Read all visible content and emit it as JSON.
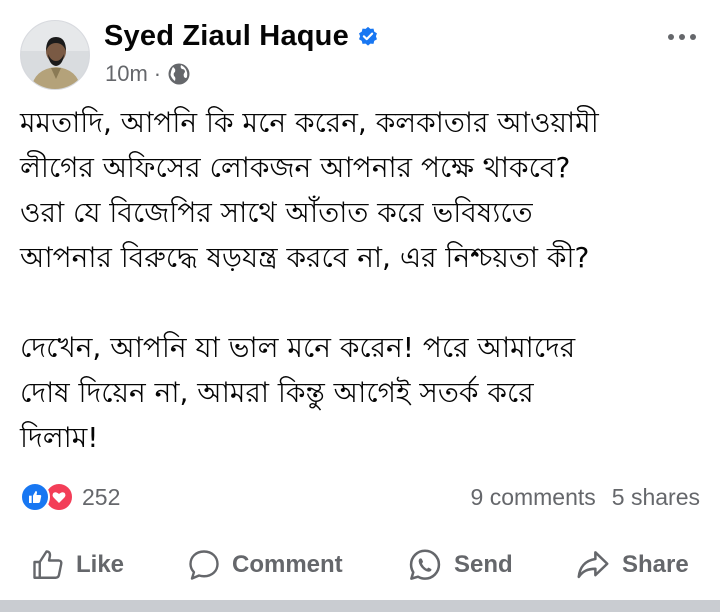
{
  "post": {
    "author": "Syed Ziaul Haque",
    "time": "10m",
    "separator": "·",
    "paragraphs": [
      "মমতাদি, আপনি কি মনে করেন, কলকাতার আওয়ামী\nলীগের অফিসের লোকজন আপনার পক্ষে থাকবে?\nওরা যে বিজেপির সাথে আঁতাত করে ভবিষ্যতে\nআপনার বিরুদ্ধে ষড়যন্ত্র করবে না, এর নিশ্চয়তা কী?",
      "দেখেন, আপনি যা ভাল মনে করেন! পরে আমাদের\nদোষ দিয়েন না, আমরা কিন্তু আগেই সতর্ক করে\nদিলাম!"
    ],
    "reaction_count": "252",
    "comments": "9 comments",
    "shares": "5 shares"
  },
  "actions": {
    "like": "Like",
    "comment": "Comment",
    "send": "Send",
    "share": "Share"
  },
  "icons": {
    "verified": "verified-badge-icon",
    "privacy": "globe-icon",
    "more": "more-options-icon",
    "like_reaction": "like-reaction-icon",
    "love_reaction": "love-reaction-icon"
  },
  "colors": {
    "accent": "#1877f2",
    "love": "#f33e58",
    "muted": "#65676b"
  }
}
